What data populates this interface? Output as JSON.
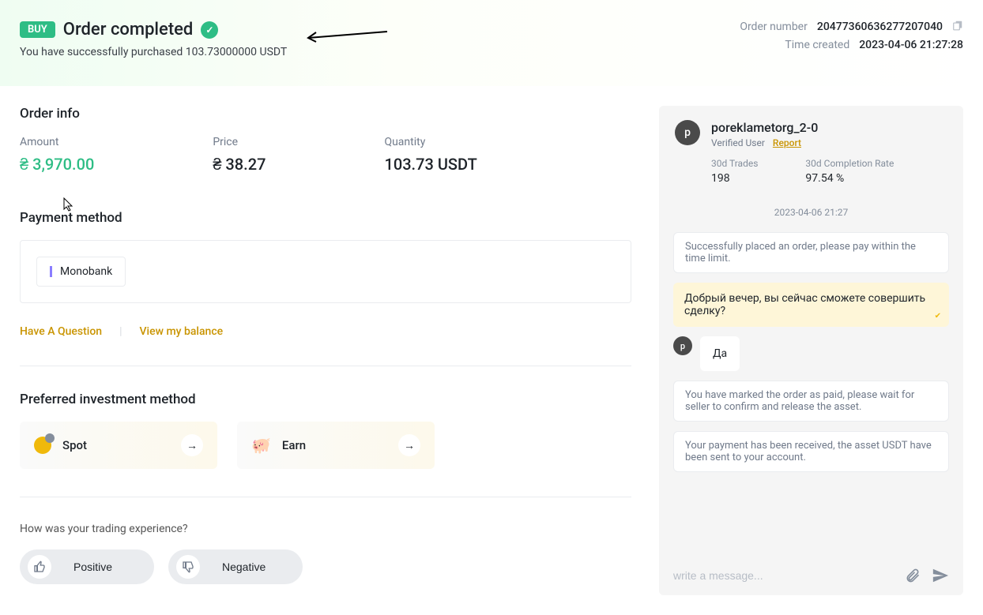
{
  "header": {
    "buy_badge": "BUY",
    "title": "Order completed",
    "subtitle": "You have successfully purchased 103.73000000 USDT",
    "order_number_label": "Order number",
    "order_number": "20477360636277207040",
    "time_created_label": "Time created",
    "time_created": "2023-04-06 21:27:28"
  },
  "order_info": {
    "title": "Order info",
    "amount_label": "Amount",
    "amount": "₴ 3,970.00",
    "price_label": "Price",
    "price": "₴ 38.27",
    "quantity_label": "Quantity",
    "quantity": "103.73 USDT"
  },
  "payment_method": {
    "title": "Payment method",
    "chip": "Monobank"
  },
  "links": {
    "question": "Have A Question",
    "balance": "View my balance"
  },
  "invest": {
    "title": "Preferred investment method",
    "spot": "Spot",
    "earn": "Earn"
  },
  "rating": {
    "question": "How was your trading experience?",
    "positive": "Positive",
    "negative": "Negative"
  },
  "chat": {
    "seller": "poreklametorg_2-0",
    "avatar_letter": "p",
    "verified": "Verified User",
    "report": "Report",
    "trades_label": "30d Trades",
    "trades_val": "198",
    "rate_label": "30d Completion Rate",
    "rate_val": "97.54 %",
    "timestamp": "2023-04-06 21:27",
    "sys_placed": "Successfully placed an order, please pay within the time limit.",
    "my_msg": "Добрый вечер, вы сейчас сможете совершить сделку?",
    "peer_msg": "Да",
    "sys_paid": "You have marked the order as paid, please wait for seller to confirm and release the asset.",
    "sys_received": "Your payment has been received, the asset USDT have been sent to your account.",
    "input_placeholder": "write a message..."
  }
}
